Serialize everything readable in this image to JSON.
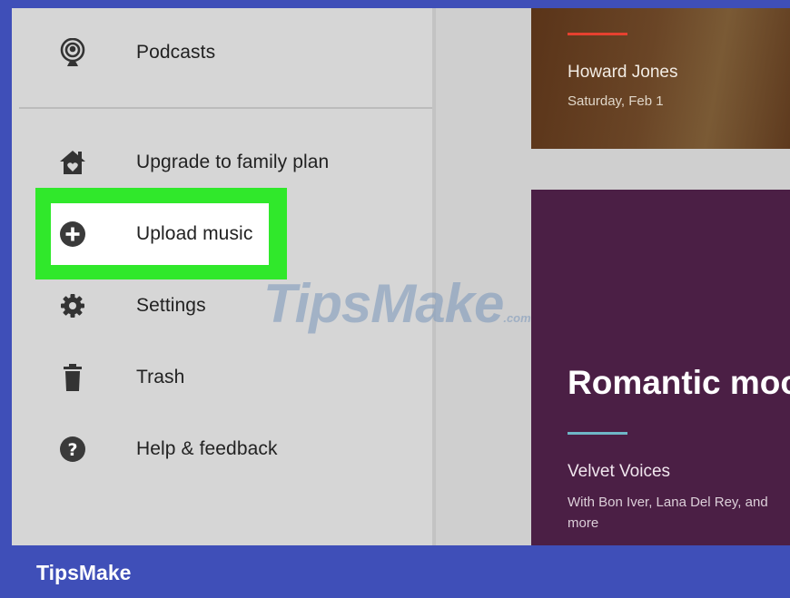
{
  "drawer": {
    "items": [
      {
        "label": "Podcasts",
        "icon": "podcast-icon"
      },
      {
        "label": "Upgrade to family plan",
        "icon": "home-icon"
      },
      {
        "label": "Upload music",
        "icon": "add-circle-icon"
      },
      {
        "label": "Settings",
        "icon": "gear-icon"
      },
      {
        "label": "Trash",
        "icon": "trash-icon"
      },
      {
        "label": "Help & feedback",
        "icon": "help-icon"
      }
    ]
  },
  "content": {
    "event_card": {
      "artist": "Howard Jones",
      "date": "Saturday, Feb 1"
    },
    "mood_card": {
      "title": "Romantic moo",
      "playlist": "Velvet Voices",
      "description": "With Bon Iver, Lana Del Rey, and more"
    }
  },
  "watermark": {
    "text": "TipsMake",
    "suffix": ".com"
  },
  "footer": {
    "brand": "TipsMake"
  },
  "colors": {
    "highlight": "#30e82b",
    "frame_blue": "#3f4fb8",
    "mood_card": "#4b1f45",
    "event_card": "#6a4526"
  }
}
